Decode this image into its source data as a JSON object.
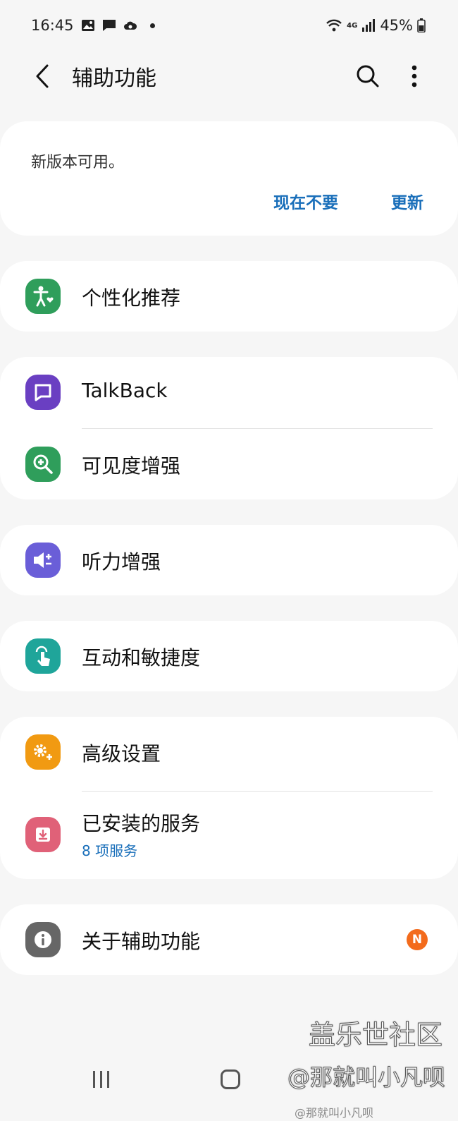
{
  "status_bar": {
    "time": "16:45",
    "battery": "45%",
    "network": "4G"
  },
  "app_bar": {
    "title": "辅助功能"
  },
  "update_card": {
    "message": "新版本可用。",
    "later_label": "现在不要",
    "update_label": "更新"
  },
  "items": {
    "personalized": {
      "label": "个性化推荐",
      "color": "#2f9e5b"
    },
    "talkback": {
      "label": "TalkBack",
      "color": "#6a3fc2"
    },
    "visibility": {
      "label": "可见度增强",
      "color": "#2f9e5b"
    },
    "hearing": {
      "label": "听力增强",
      "color": "#6a5ed8"
    },
    "interaction": {
      "label": "互动和敏捷度",
      "color": "#1fa59a"
    },
    "advanced": {
      "label": "高级设置",
      "color": "#f19a12"
    },
    "installed": {
      "label": "已安装的服务",
      "sub": "8 项服务",
      "color": "#e06178"
    },
    "about": {
      "label": "关于辅助功能",
      "badge": "N",
      "color": "#666666"
    }
  },
  "watermark": {
    "line1": "盖乐世社区",
    "line2": "@那就叫小凡呗",
    "line3": "@那就叫小凡呗"
  }
}
